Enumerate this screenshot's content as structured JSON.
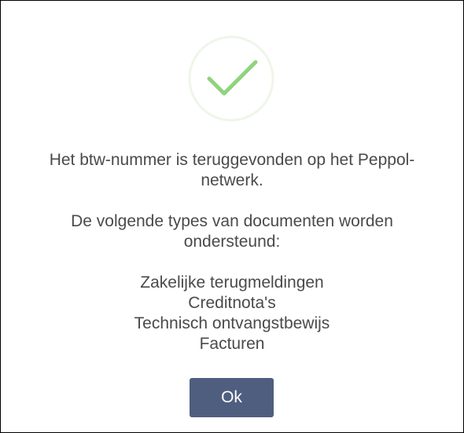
{
  "dialog": {
    "icon": "checkmark-success-icon",
    "colors": {
      "icon_ring": "#eef6e8",
      "icon_check": "#90d47d",
      "text": "#4a4a4a",
      "button_bg": "#4f5e7f",
      "button_text": "#ffffff"
    },
    "message": {
      "line1": "Het btw-nummer is teruggevonden op het Peppol-",
      "line2": "netwerk."
    },
    "types_intro": {
      "line1": "De volgende types van documenten worden",
      "line2": "ondersteund:"
    },
    "document_types": [
      "Zakelijke terugmeldingen",
      "Creditnota's",
      "Technisch ontvangstbewijs",
      "Facturen"
    ],
    "ok_label": "Ok"
  }
}
